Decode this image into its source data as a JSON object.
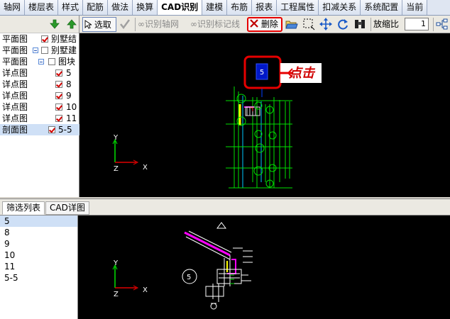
{
  "menu": {
    "tabs": [
      "轴网",
      "楼层表",
      "样式",
      "配筋",
      "做法",
      "换算",
      "CAD识别",
      "建模",
      "布筋",
      "报表",
      "工程属性",
      "扣减关系",
      "系统配置",
      "当前"
    ],
    "active_index": 6
  },
  "toolbar": {
    "select_label": "选取",
    "identify_axis_label": "识别轴网",
    "identify_mark_label": "识别标记线",
    "delete_label": "删除",
    "zoom_label": "放缩比",
    "zoom_value": "1"
  },
  "tree": {
    "items": [
      {
        "type": "平面图",
        "name": "别墅结",
        "checked": true
      },
      {
        "type": "平面图",
        "name": "别墅建",
        "checked": false
      },
      {
        "type": "平面图",
        "name": "图块",
        "checked": false
      },
      {
        "type": "详点图",
        "name": "5",
        "checked": true
      },
      {
        "type": "详点图",
        "name": "8",
        "checked": true
      },
      {
        "type": "详点图",
        "name": "9",
        "checked": true
      },
      {
        "type": "详点图",
        "name": "10",
        "checked": true
      },
      {
        "type": "详点图",
        "name": "11",
        "checked": true
      },
      {
        "type": "剖面图",
        "name": "5-5",
        "checked": true
      }
    ]
  },
  "bottom_tabs": [
    "筛选列表",
    "CAD详图"
  ],
  "filter_list": [
    "5",
    "8",
    "9",
    "10",
    "11",
    "5-5"
  ],
  "canvas_top": {
    "marker_label": "5",
    "callout_text": "点击",
    "axis_y": "Y",
    "axis_z": "Z",
    "axis_x": "X"
  },
  "canvas_bottom": {
    "circle_label": "5",
    "axis_y": "Y",
    "axis_z": "Z",
    "axis_x": "X"
  },
  "colors": {
    "highlight_red": "#e60000",
    "cad_green": "#00e000",
    "cad_magenta": "#ff00ff",
    "cad_yellow": "#ffff00"
  }
}
